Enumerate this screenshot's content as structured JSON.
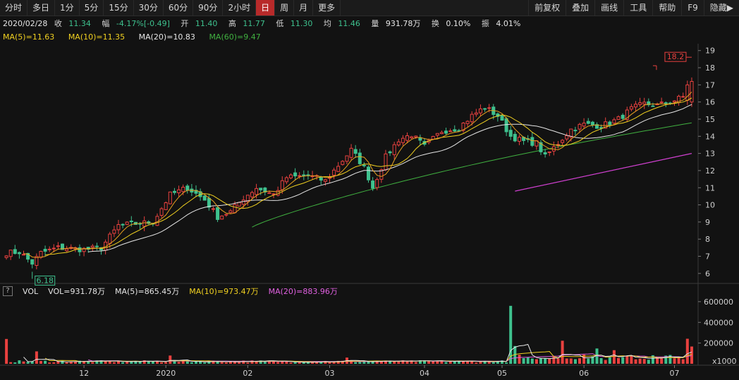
{
  "toolbar": {
    "periods": [
      "分时",
      "多日",
      "1分",
      "5分",
      "15分",
      "30分",
      "60分",
      "90分",
      "2小时",
      "日",
      "周",
      "月",
      "更多"
    ],
    "active_period": "日",
    "tools": [
      "前复权",
      "叠加",
      "画线",
      "工具",
      "帮助",
      "F9",
      "隐藏▶"
    ]
  },
  "info": {
    "date": "2020/02/28",
    "close_label": "收",
    "close": "11.34",
    "change_label": "幅",
    "change": "-4.17%[-0.49]",
    "open_label": "开",
    "open": "11.40",
    "high_label": "高",
    "high": "11.77",
    "low_label": "低",
    "low": "11.30",
    "avg_label": "均",
    "avg": "11.46",
    "vol_label": "量",
    "vol": "931.78万",
    "turnover_label": "换",
    "turnover": "0.10%",
    "amp_label": "振",
    "amp": "4.01%"
  },
  "ma": {
    "ma5": "MA(5)=11.63",
    "ma10": "MA(10)=11.35",
    "ma20": "MA(20)=10.83",
    "ma60": "MA(60)=9.47"
  },
  "vol": {
    "help": "?",
    "name": "VOL",
    "vol": "VOL=931.78万",
    "ma5": "MA(5)=865.45万",
    "ma10": "MA(10)=973.47万",
    "ma20": "MA(20)=883.96万"
  },
  "colors": {
    "up": "#e8413f",
    "down": "#3ec18e",
    "ma5": "#e6e6e6",
    "ma10": "#f0d020",
    "ma20": "#d040d0",
    "ma60": "#40b040",
    "vol_ma5": "#e6e6e6",
    "vol_ma10": "#f0d020",
    "vol_ma20": "#e060e0"
  },
  "chart_data": {
    "type": "candlestick",
    "price_axis": {
      "ticks": [
        6,
        7,
        8,
        9,
        10,
        11,
        12,
        13,
        14,
        15,
        16,
        17,
        18,
        19
      ],
      "ylim": [
        5.5,
        19.4
      ]
    },
    "volume_axis": {
      "ticks": [
        200000,
        400000,
        600000
      ],
      "tick_labels": [
        "200000",
        "400000",
        "600000"
      ],
      "unit": "x1000",
      "ylim": [
        0,
        640000
      ]
    },
    "x_labels": [
      "12",
      "2020",
      "02",
      "03",
      "04",
      "05",
      "06",
      "07"
    ],
    "x_label_positions": [
      18,
      37,
      56,
      75,
      97,
      115,
      134,
      155
    ],
    "n_bars": 160,
    "annotations": {
      "max": "18.2",
      "min": "6.18"
    },
    "price_anchors": [
      [
        0,
        7.2
      ],
      [
        3,
        7.25
      ],
      [
        6,
        6.6
      ],
      [
        8,
        7.2
      ],
      [
        12,
        7.5
      ],
      [
        18,
        7.4
      ],
      [
        22,
        7.5
      ],
      [
        26,
        8.8
      ],
      [
        30,
        8.9
      ],
      [
        34,
        9.0
      ],
      [
        38,
        10.6
      ],
      [
        42,
        11.0
      ],
      [
        46,
        10.3
      ],
      [
        49,
        9.3
      ],
      [
        52,
        9.6
      ],
      [
        55,
        10.4
      ],
      [
        58,
        11.0
      ],
      [
        62,
        10.6
      ],
      [
        65,
        11.6
      ],
      [
        70,
        11.7
      ],
      [
        74,
        11.4
      ],
      [
        78,
        12.6
      ],
      [
        80,
        13.2
      ],
      [
        83,
        12.2
      ],
      [
        85,
        11.0
      ],
      [
        88,
        12.8
      ],
      [
        91,
        13.8
      ],
      [
        94,
        14.1
      ],
      [
        97,
        13.4
      ],
      [
        101,
        14.3
      ],
      [
        105,
        14.5
      ],
      [
        108,
        15.2
      ],
      [
        111,
        15.7
      ],
      [
        114,
        15.2
      ],
      [
        117,
        14.0
      ],
      [
        120,
        13.7
      ],
      [
        123,
        13.6
      ],
      [
        125,
        12.8
      ],
      [
        128,
        13.6
      ],
      [
        131,
        14.4
      ],
      [
        134,
        14.7
      ],
      [
        138,
        14.6
      ],
      [
        142,
        15.0
      ],
      [
        145,
        15.6
      ],
      [
        148,
        15.9
      ],
      [
        151,
        15.8
      ],
      [
        154,
        16.0
      ],
      [
        157,
        16.3
      ],
      [
        158,
        17.3
      ],
      [
        159,
        18.2
      ]
    ],
    "volume_spikes": [
      [
        0,
        240000
      ],
      [
        7,
        120000
      ],
      [
        38,
        80000
      ],
      [
        79,
        60000
      ],
      [
        117,
        560000
      ],
      [
        118,
        130000
      ],
      [
        129,
        180000
      ],
      [
        137,
        110000
      ],
      [
        141,
        110000
      ],
      [
        158,
        190000
      ],
      [
        159,
        120000
      ]
    ],
    "ma60_start": 57,
    "ma60_end": 14.8,
    "ma120_segment": {
      "start": [
        118,
        10.8
      ],
      "end": [
        159,
        13.0
      ]
    }
  }
}
